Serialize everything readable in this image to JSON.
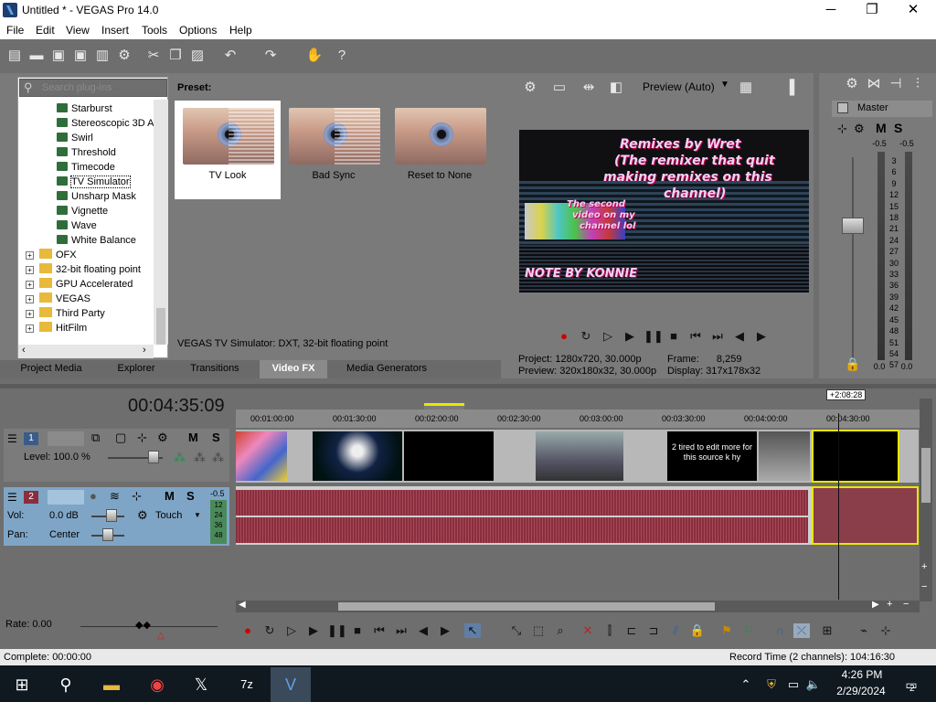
{
  "window": {
    "title": "Untitled * - VEGAS Pro 14.0",
    "minimize": "─",
    "maximize": "❐",
    "close": "✕"
  },
  "menu": [
    "File",
    "Edit",
    "View",
    "Insert",
    "Tools",
    "Options",
    "Help"
  ],
  "plugin_chooser": {
    "search_placeholder": "Search plug-ins",
    "fx_items": [
      "Starburst",
      "Stereoscopic 3D A",
      "Swirl",
      "Threshold",
      "Timecode",
      "TV Simulator",
      "Unsharp Mask",
      "Vignette",
      "Wave",
      "White Balance"
    ],
    "selected": "TV Simulator",
    "folders": [
      "OFX",
      "32-bit floating point",
      "GPU Accelerated",
      "VEGAS",
      "Third Party",
      "HitFilm"
    ],
    "preset_label": "Preset:",
    "presets": [
      "TV Look",
      "Bad Sync",
      "Reset to None"
    ],
    "description": "VEGAS TV Simulator: DXT, 32-bit floating point"
  },
  "tabs": [
    "Project Media",
    "Explorer",
    "Transitions",
    "Video FX",
    "Media Generators"
  ],
  "active_tab": "Video FX",
  "preview": {
    "mode": "Preview (Auto)",
    "video_text_1": "Remixes by Wret",
    "video_text_2": "(The remixer that quit",
    "video_text_3": "making remixes on this",
    "video_text_4": "channel)",
    "video_text_5": "The second",
    "video_text_6": "video on my",
    "video_text_7": "channel lol",
    "video_text_8": "NOTE BY KONNIE",
    "project_label": "Project:",
    "project_value": "1280x720, 30.000p",
    "preview_label": "Preview:",
    "preview_value": "320x180x32, 30.000p",
    "frame_label": "Frame:",
    "frame_value": "8,259",
    "display_label": "Display:",
    "display_value": "317x178x32"
  },
  "master": {
    "title": "Master",
    "m": "M",
    "s": "S",
    "scale_top": "-0.5",
    "scale": [
      "3",
      "6",
      "9",
      "12",
      "15",
      "18",
      "21",
      "24",
      "27",
      "30",
      "33",
      "36",
      "39",
      "42",
      "45",
      "48",
      "51",
      "54",
      "57"
    ],
    "bottom_left": "0.0",
    "bottom_right": "0.0"
  },
  "timeline": {
    "timecode": "00:04:35:09",
    "marker": "+2:08:28",
    "ruler": [
      "00:01:00:00",
      "00:01:30:00",
      "00:02:00:00",
      "00:02:30:00",
      "00:03:00:00",
      "00:03:30:00",
      "00:04:00:00",
      "00:04:30:00"
    ],
    "track1": {
      "num": "1",
      "level": "Level: 100.0 %",
      "m": "M",
      "s": "S"
    },
    "track2": {
      "num": "2",
      "vol_label": "Vol:",
      "vol_value": "0.0 dB",
      "pan_label": "Pan:",
      "pan_value": "Center",
      "touch": "Touch",
      "m": "M",
      "s": "S",
      "meter_top": "-0.5",
      "meter_values": [
        "12",
        "24",
        "36",
        "48"
      ]
    },
    "clip_text": "2 tired to edit more for this source k hy",
    "rate": "Rate: 0.00"
  },
  "status": {
    "complete": "Complete: 00:00:00",
    "record_time": "Record Time (2 channels): 104:16:30"
  },
  "taskbar": {
    "time": "4:26 PM",
    "date": "2/29/2024",
    "notifications": "2"
  }
}
